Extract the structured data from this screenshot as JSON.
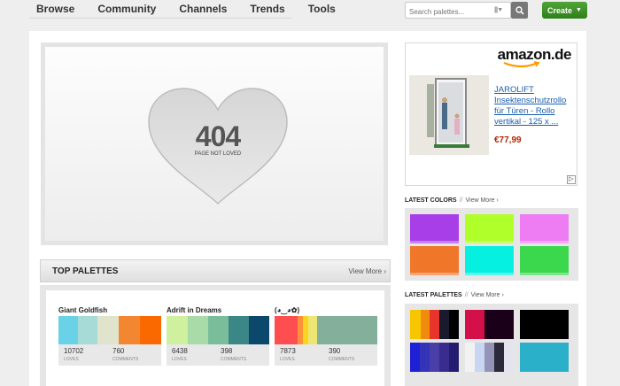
{
  "nav": {
    "items": [
      "Browse",
      "Community",
      "Channels",
      "Trends",
      "Tools"
    ],
    "search_placeholder": "Search palettes...",
    "create_label": "Create",
    "create_caret": "▼",
    "search_bars": "||||▼"
  },
  "error": {
    "code": "404",
    "message": "PAGE NOT LOVED"
  },
  "top_palettes": {
    "title": "TOP PALETTES",
    "view_more": "View More ›",
    "items": [
      {
        "name": "Giant Goldfish",
        "colors": [
          "#69d2e7",
          "#a7dbd8",
          "#e0e4cc",
          "#f38630",
          "#fa6900"
        ],
        "widths": [
          22,
          22,
          24,
          24,
          24
        ],
        "loves": "10702",
        "loves_label": "LOVES",
        "comments": "760",
        "comments_label": "COMMENTS"
      },
      {
        "name": "Adrift in Dreams",
        "colors": [
          "#cff09e",
          "#a8dba8",
          "#79bd9a",
          "#3b8686",
          "#0b486b"
        ],
        "widths": [
          24,
          23,
          23,
          23,
          23
        ],
        "loves": "6438",
        "loves_label": "LOVES",
        "comments": "398",
        "comments_label": "COMMENTS"
      },
      {
        "name": "(◕‿◕✿)",
        "colors": [
          "#ff4e50",
          "#fc913a",
          "#f9d423",
          "#ede574",
          "#83af9b"
        ],
        "widths": [
          26,
          6,
          6,
          10,
          68
        ],
        "loves": "7873",
        "loves_label": "LOVES",
        "comments": "390",
        "comments_label": "COMMENTS"
      }
    ]
  },
  "ad": {
    "brand": "amazon.de",
    "product": "JAROLIFT Insektenschutzrollo für Türen - Rollo vertikal - 125 x ...",
    "price": "€77,99",
    "adchoice": "▷"
  },
  "latest_colors": {
    "title": "LATEST COLORS",
    "sep": "//",
    "view_more": "View More ›",
    "colors": [
      "#a83ee8",
      "#b0ff2a",
      "#ee7cf2",
      "#f0762a",
      "#05f0e0",
      "#3bd84e"
    ]
  },
  "latest_palettes": {
    "title": "LATEST PALETTES",
    "sep": "//",
    "view_more": "View More ›",
    "palettes": [
      {
        "colors": [
          "#f7c600",
          "#f08b0b",
          "#e8352b",
          "#1a1a2e",
          "#000000"
        ],
        "widths": [
          12,
          10,
          11,
          11,
          11
        ]
      },
      {
        "colors": [
          "#d4104a",
          "#d4104a",
          "#1a0018",
          "#1a0018",
          "#1a0018"
        ],
        "widths": [
          11,
          11,
          11,
          11,
          11
        ]
      },
      {
        "colors": [
          "#000000",
          "#000000",
          "#000000",
          "#000000",
          "#000000"
        ],
        "widths": [
          11,
          11,
          11,
          11,
          11
        ]
      },
      {
        "colors": [
          "#1f1fd6",
          "#3434b8",
          "#4a3fa8",
          "#3a2c8e",
          "#241c6e"
        ],
        "widths": [
          11,
          11,
          11,
          11,
          11
        ]
      },
      {
        "colors": [
          "#f2f2f2",
          "#c9d6f2",
          "#9494b8",
          "#2a2a3a",
          "#e4e4ee"
        ],
        "widths": [
          11,
          11,
          11,
          11,
          11
        ]
      },
      {
        "colors": [
          "#2ab0c8",
          "#2ab0c8",
          "#2ab0c8",
          "#2ab0c8",
          "#2ab0c8"
        ],
        "widths": [
          11,
          11,
          11,
          11,
          11
        ]
      }
    ]
  }
}
